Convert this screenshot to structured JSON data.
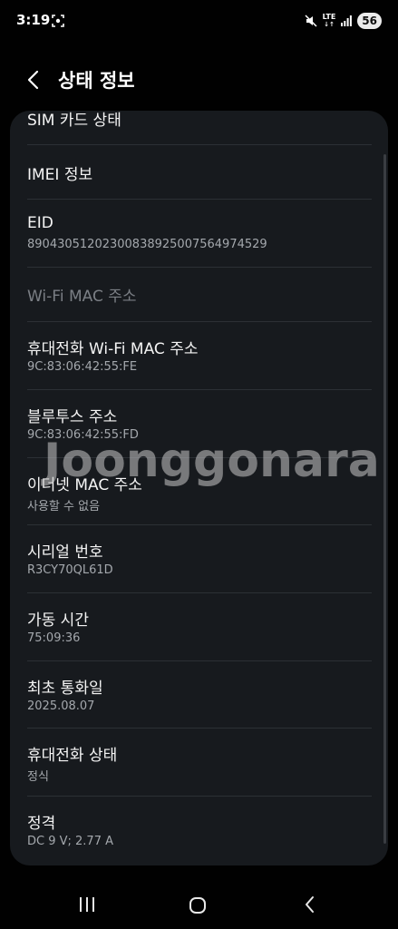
{
  "status_bar": {
    "time": "3:19",
    "network": "LTE",
    "battery": "56"
  },
  "header": {
    "title": "상태 정보"
  },
  "items": [
    {
      "title": "SIM 카드 상태",
      "subtitle": ""
    },
    {
      "title": "IMEI 정보",
      "subtitle": ""
    },
    {
      "title": "EID",
      "subtitle": "89043051202300838925007564974529"
    },
    {
      "title": "Wi-Fi MAC 주소",
      "subtitle": "",
      "disabled": true
    },
    {
      "title": "휴대전화 Wi-Fi MAC 주소",
      "subtitle": "9C:83:06:42:55:FE"
    },
    {
      "title": "블루투스 주소",
      "subtitle": "9C:83:06:42:55:FD"
    },
    {
      "title": "이더넷 MAC 주소",
      "subtitle": "사용할 수 없음"
    },
    {
      "title": "시리얼 번호",
      "subtitle": "R3CY70QL61D"
    },
    {
      "title": "가동 시간",
      "subtitle": "75:09:36"
    },
    {
      "title": "최초 통화일",
      "subtitle": "2025.08.07"
    },
    {
      "title": "휴대전화 상태",
      "subtitle": "정식"
    },
    {
      "title": "정격",
      "subtitle": "DC 9 V; 2.77 A"
    }
  ],
  "watermark": "Joonggonara",
  "colors": {
    "background": "#010101",
    "card": "#171a1e",
    "text": "#f4f4f4",
    "subtext": "#a4a8ad",
    "disabled": "#7b7f85"
  }
}
